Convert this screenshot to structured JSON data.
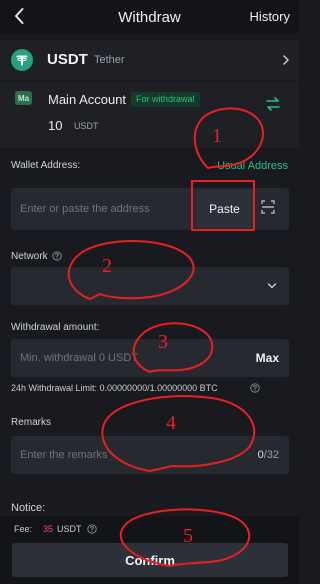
{
  "header": {
    "title": "Withdraw",
    "history_label": "History"
  },
  "coin": {
    "symbol": "USDT",
    "name": "Tether"
  },
  "account": {
    "icon_label": "Ma",
    "label": "Main Account",
    "badge": "For withdrawal",
    "balance": "10",
    "unit": "USDT"
  },
  "address": {
    "label": "Wallet Address:",
    "usual_label": "Usual Address",
    "placeholder": "Enter or paste the address",
    "paste_label": "Paste"
  },
  "network": {
    "label": "Network"
  },
  "amount": {
    "label": "Withdrawal amount:",
    "placeholder": "Min. withdrawal 0 USDT",
    "max_label": "Max",
    "limit_text": "24h Withdrawal Limit: 0.00000000/1.00000000 BTC"
  },
  "remarks": {
    "label": "Remarks",
    "placeholder": "Enter the remarks",
    "count": "0",
    "max": "/32"
  },
  "notice": "Notice:",
  "fee": {
    "label": "Fee:",
    "amount": "35",
    "unit": "USDT"
  },
  "confirm_label": "Confirm",
  "annotations": [
    "1",
    "2",
    "3",
    "4",
    "5"
  ],
  "colors": {
    "accent": "#25c27d",
    "fee": "#f6465d",
    "annotation": "#e82020",
    "coin": "#26a17b"
  },
  "icons": [
    "back-icon",
    "tether-icon",
    "chevron-right-icon",
    "main-account-icon",
    "transfer-icon",
    "scan-icon",
    "info-icon",
    "chevron-down-icon"
  ]
}
